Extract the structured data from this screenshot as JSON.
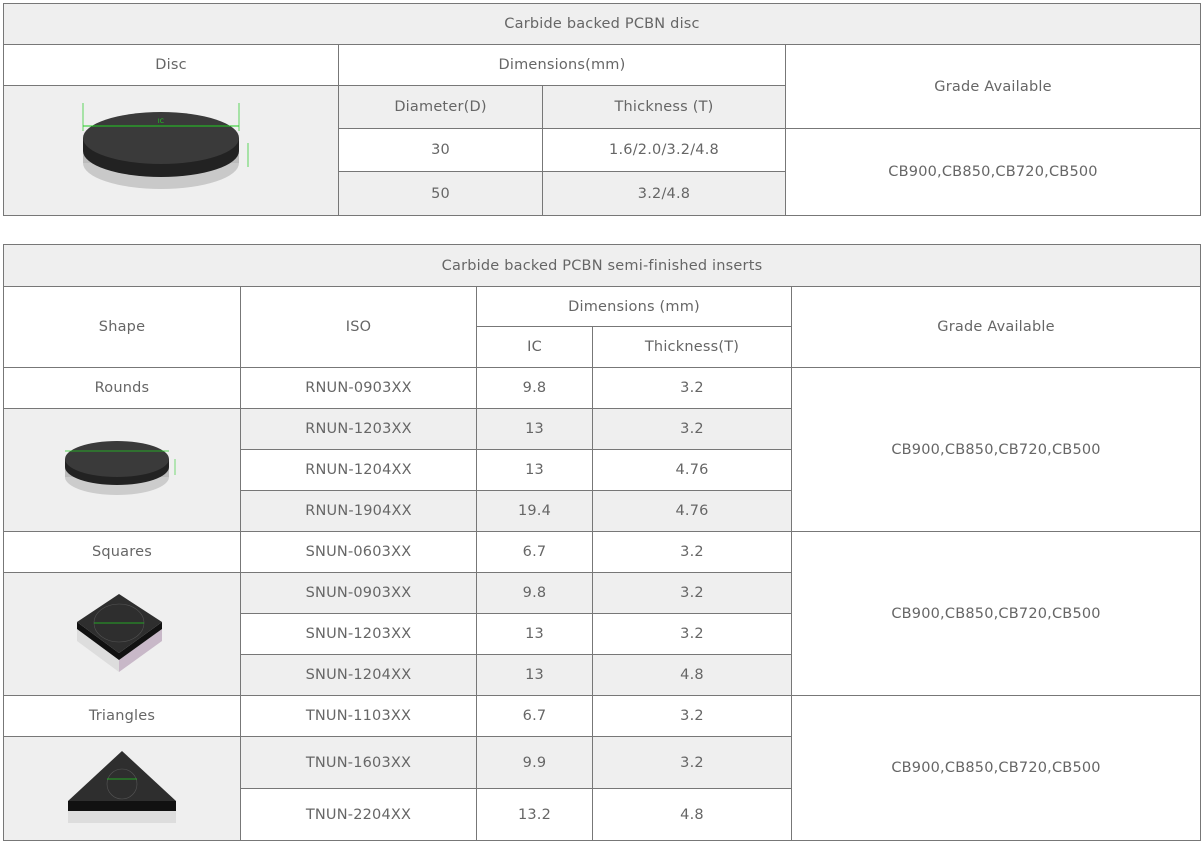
{
  "disc_table": {
    "title": "Carbide  backed  PCBN  disc",
    "headers": {
      "disc": "Disc",
      "dimensions": "Dimensions(mm)",
      "grade": "Grade  Available",
      "diameter": "Diameter(D)",
      "thickness": "Thickness  (T)"
    },
    "image_label": "IC",
    "rows": [
      {
        "diameter": "30",
        "thickness": "1.6/2.0/3.2/4.8"
      },
      {
        "diameter": "50",
        "thickness": "3.2/4.8"
      }
    ],
    "grade": "CB900,CB850,CB720,CB500"
  },
  "inserts_table": {
    "title": "Carbide  backed  PCBN  semi-finished  inserts",
    "headers": {
      "shape": "Shape",
      "iso": "ISO",
      "dimensions": "Dimensions  (mm)",
      "grade": "Grade  Available",
      "ic": "IC",
      "thickness": "Thickness(T)"
    },
    "groups": [
      {
        "shape": "Rounds",
        "grade": "CB900,CB850,CB720,CB500",
        "rows": [
          {
            "iso": "RNUN-0903XX",
            "ic": "9.8",
            "t": "3.2"
          },
          {
            "iso": "RNUN-1203XX",
            "ic": "13",
            "t": "3.2"
          },
          {
            "iso": "RNUN-1204XX",
            "ic": "13",
            "t": "4.76"
          },
          {
            "iso": "RNUN-1904XX",
            "ic": "19.4",
            "t": "4.76"
          }
        ]
      },
      {
        "shape": "Squares",
        "grade": "CB900,CB850,CB720,CB500",
        "rows": [
          {
            "iso": "SNUN-0603XX",
            "ic": "6.7",
            "t": "3.2"
          },
          {
            "iso": "SNUN-0903XX",
            "ic": "9.8",
            "t": "3.2"
          },
          {
            "iso": "SNUN-1203XX",
            "ic": "13",
            "t": "3.2"
          },
          {
            "iso": "SNUN-1204XX",
            "ic": "13",
            "t": "4.8"
          }
        ]
      },
      {
        "shape": "Triangles",
        "grade": "CB900,CB850,CB720,CB500",
        "rows": [
          {
            "iso": "TNUN-1103XX",
            "ic": "6.7",
            "t": "3.2"
          },
          {
            "iso": "TNUN-1603XX",
            "ic": "9.9",
            "t": "3.2"
          },
          {
            "iso": "TNUN-2204XX",
            "ic": "13.2",
            "t": "4.8"
          }
        ]
      }
    ]
  }
}
